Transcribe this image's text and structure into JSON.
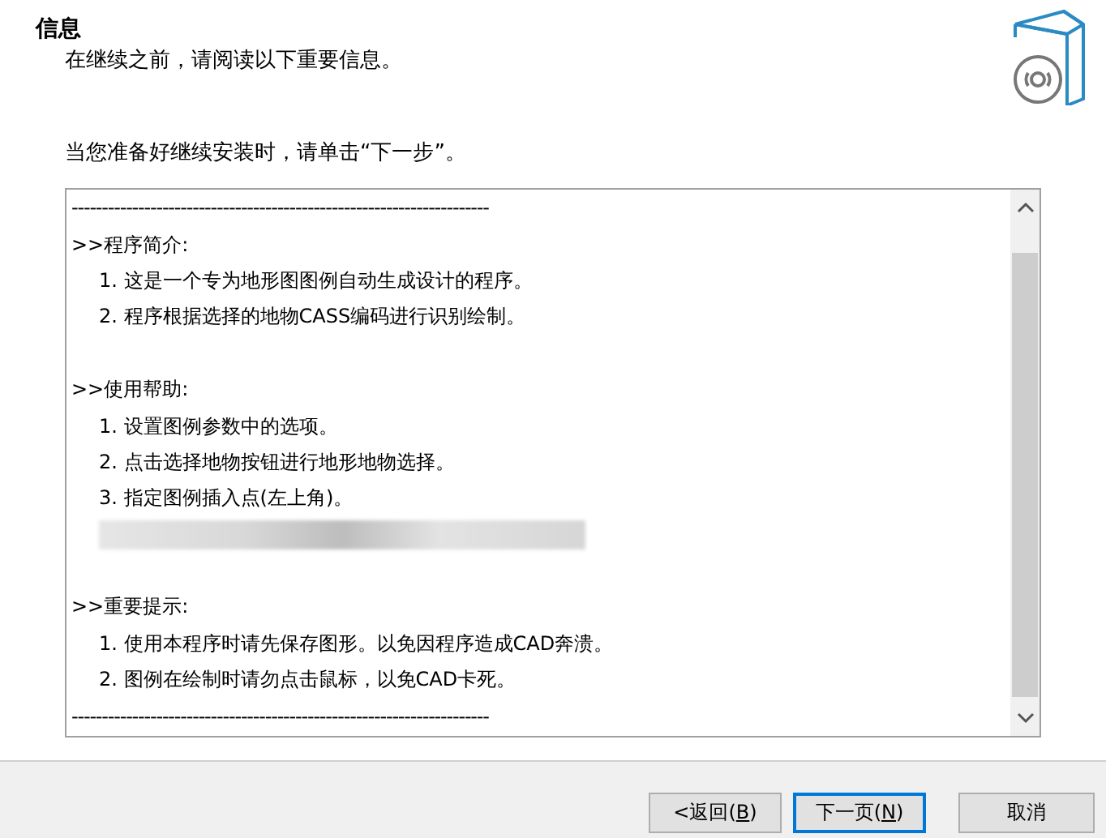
{
  "header": {
    "title": "信息",
    "subtitle": "在继续之前，请阅读以下重要信息。"
  },
  "instruction": "当您准备好继续安装时，请单击“下一步”。",
  "memo": {
    "lines": [
      {
        "kind": "rule",
        "text": "---------------------------------------------------------------------"
      },
      {
        "kind": "heading",
        "text": ">>程序简介:"
      },
      {
        "kind": "item",
        "text": "1. 这是一个专为地形图图例自动生成设计的程序。"
      },
      {
        "kind": "item",
        "text": "2. 程序根据选择的地物CASS编码进行识别绘制。"
      },
      {
        "kind": "blank"
      },
      {
        "kind": "heading",
        "text": ">>使用帮助:"
      },
      {
        "kind": "item",
        "text": "1. 设置图例参数中的选项。"
      },
      {
        "kind": "item",
        "text": "2. 点击选择地物按钮进行地形地物选择。"
      },
      {
        "kind": "item",
        "text": "3. 指定图例插入点(左上角)。"
      },
      {
        "kind": "redacted"
      },
      {
        "kind": "blank"
      },
      {
        "kind": "heading",
        "text": ">>重要提示:"
      },
      {
        "kind": "item",
        "text": "1. 使用本程序时请先保存图形。以免因程序造成CAD奔溃。"
      },
      {
        "kind": "item",
        "text": "2. 图例在绘制时请勿点击鼠标，以免CAD卡死。"
      },
      {
        "kind": "rule",
        "text": "---------------------------------------------------------------------"
      }
    ]
  },
  "buttons": [
    {
      "label_before": "<返回(",
      "access_key": "B",
      "label_after": ")",
      "default": false
    },
    {
      "label_before": "下一页(",
      "access_key": "N",
      "label_after": ")",
      "default": true
    },
    {
      "label_before": "取消",
      "default": false
    }
  ]
}
